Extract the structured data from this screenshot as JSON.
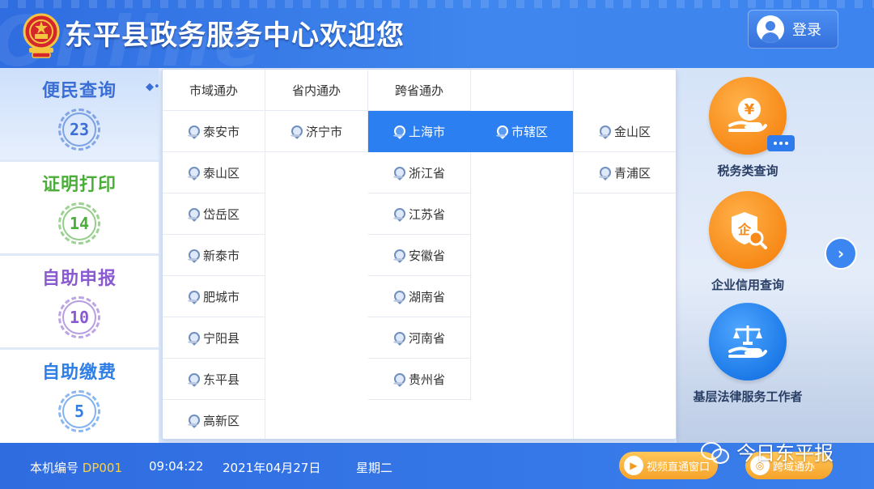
{
  "header": {
    "title": "东平县政务服务中心欢迎您",
    "bg_text": "Online",
    "login_label": "登录"
  },
  "left_menu": [
    {
      "label": "便民查询",
      "count": "23",
      "color": "#3b6fd6",
      "active": true
    },
    {
      "label": "证明打印",
      "count": "14",
      "color": "#4cae3a",
      "active": false
    },
    {
      "label": "自助申报",
      "count": "10",
      "color": "#8a5bd0",
      "active": false
    },
    {
      "label": "自助缴费",
      "count": "5",
      "color": "#2f7fe6",
      "active": false
    }
  ],
  "panel": {
    "headers": [
      "市域通办",
      "省内通办",
      "跨省通办"
    ],
    "city_list": [
      "泰安市",
      "泰山区",
      "岱岳区",
      "新泰市",
      "肥城市",
      "宁阳县",
      "东平县",
      "高新区"
    ],
    "province_list": [
      "济宁市"
    ],
    "cross_province_list": [
      "上海市",
      "浙江省",
      "江苏省",
      "安徽省",
      "湖南省",
      "河南省",
      "贵州省"
    ],
    "sub_list": [
      "市辖区"
    ],
    "district_list": [
      "金山区",
      "青浦区"
    ]
  },
  "services": [
    {
      "label": "税务类查询",
      "icon": "tax-yuan-hand-icon"
    },
    {
      "label": "企业信用查询",
      "icon": "enterprise-search-icon"
    },
    {
      "label": "基层法律服务工作者",
      "icon": "scales-hand-icon"
    }
  ],
  "footer": {
    "machine_label": "本机编号",
    "machine_code": "DP001",
    "time": "09:04:22",
    "date": "2021年04月27日",
    "weekday": "星期二",
    "video_btn": "视频直通窗口",
    "cross_btn": "跨域通办",
    "watermark": "今日东平报"
  },
  "colors": {
    "primary": "#3b7ff0",
    "selected": "#2b7ff0",
    "orange": "#f78a18",
    "code": "#ffd23c"
  }
}
